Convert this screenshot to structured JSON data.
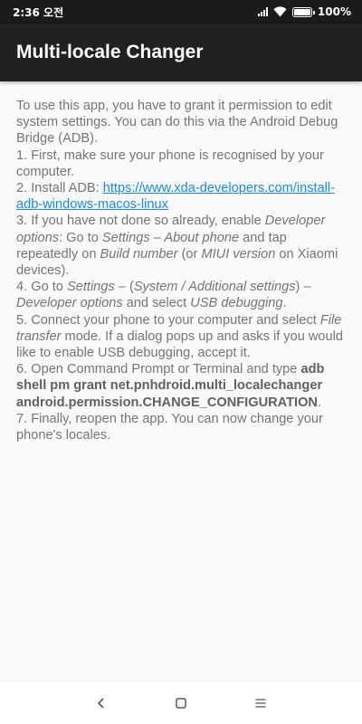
{
  "status_bar": {
    "time": "2:36 오전",
    "battery": "100%"
  },
  "app_bar": {
    "title": "Multi-locale Changer"
  },
  "instructions": {
    "intro": "To use this app, you have to grant it permission to edit system settings. You can do this via the Android Debug Bridge (ADB).",
    "step1": "1. First, make sure your phone is recognised by your computer.",
    "step2_prefix": "2. Install ADB: ",
    "step2_link": "https://www.xda-developers.com/install-adb-windows-macos-linux",
    "step3": {
      "a": " 3. If you have not done so already, enable ",
      "b": "Developer options",
      "c": ": Go to ",
      "d": "Settings – About phone",
      "e": " and tap repeatedly on ",
      "f": "Build number",
      "g": " (or ",
      "h": "MIUI version",
      "i": " on Xiaomi devices)."
    },
    "step4": {
      "a": "4. Go to ",
      "b": "Settings",
      "c": " – (",
      "d": "System / Additional settings",
      "e": ") – ",
      "f": "Developer options",
      "g": " and select ",
      "h": "USB debugging",
      "i": "."
    },
    "step5": {
      "a": "5. Connect your phone to your computer and select ",
      "b": "File transfer",
      "c": " mode. If a dialog pops up and asks if you would like to enable USB debugging, accept it."
    },
    "step6": {
      "a": "6. Open Command Prompt or Terminal and type ",
      "b": "adb shell pm grant net.pnhdroid.multi_localechanger android.permission.CHANGE_CONFIGURATION",
      "c": "."
    },
    "step7": "7. Finally, reopen the app. You can now change your phone's locales."
  },
  "nav_bar": {
    "icons": [
      "back-icon",
      "home-icon",
      "menu-icon"
    ]
  },
  "colors": {
    "app_bar": "#212121",
    "status_bar": "#1b1b1b",
    "body_text": "#757575",
    "link": "#1e88e5",
    "background": "#fafafa"
  }
}
